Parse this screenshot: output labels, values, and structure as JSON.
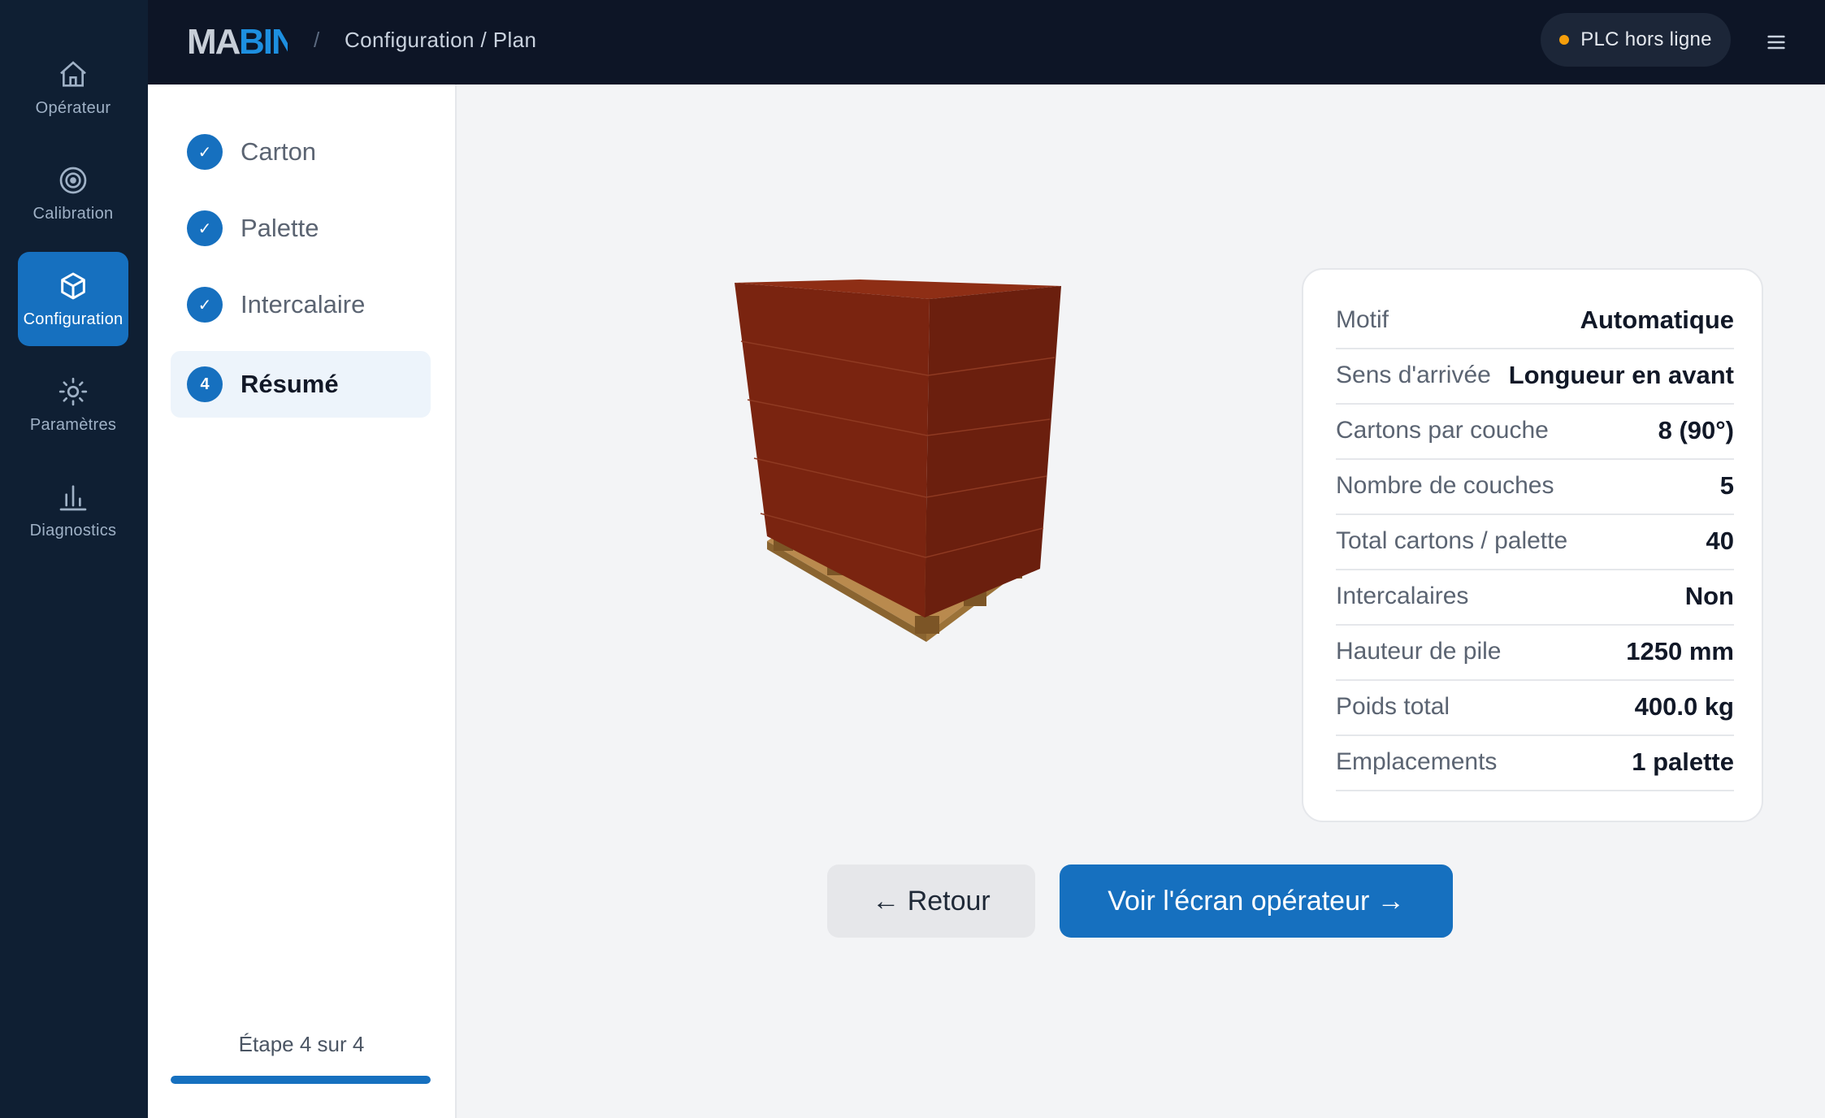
{
  "nav": [
    {
      "label": "Opérateur",
      "icon": "home-icon",
      "active": false
    },
    {
      "label": "Calibration",
      "icon": "target-icon",
      "active": false
    },
    {
      "label": "Configuration",
      "icon": "cube-icon",
      "active": true
    },
    {
      "label": "Paramètres",
      "icon": "gear-icon",
      "active": false
    },
    {
      "label": "Diagnostics",
      "icon": "bar-chart-icon",
      "active": false
    }
  ],
  "header": {
    "logo": "MABIN",
    "separator": "/",
    "breadcrumb": "Configuration / Plan",
    "plc_status": "PLC hors ligne",
    "plc_color": "#f59e0b"
  },
  "steps": [
    {
      "label": "Carton",
      "badge": "✓",
      "state": "done"
    },
    {
      "label": "Palette",
      "badge": "✓",
      "state": "done"
    },
    {
      "label": "Intercalaire",
      "badge": "✓",
      "state": "done"
    },
    {
      "label": "Résumé",
      "badge": "4",
      "state": "current"
    }
  ],
  "progress": {
    "text": "Étape 4 sur 4",
    "fraction": 1.0
  },
  "summary": [
    {
      "key": "Motif",
      "value": "Automatique"
    },
    {
      "key": "Sens d'arrivée",
      "value": "Longueur en avant"
    },
    {
      "key": "Cartons par couche",
      "value": "8 (90°)"
    },
    {
      "key": "Nombre de couches",
      "value": "5"
    },
    {
      "key": "Total cartons / palette",
      "value": "40"
    },
    {
      "key": "Intercalaires",
      "value": "Non"
    },
    {
      "key": "Hauteur de pile",
      "value": "1250 mm"
    },
    {
      "key": "Poids total",
      "value": "400.0 kg"
    },
    {
      "key": "Emplacements",
      "value": "1 palette"
    }
  ],
  "buttons": {
    "back": "← Retour",
    "next": "Voir l'écran opérateur →"
  },
  "colors": {
    "accent": "#1670bf",
    "sidebar_bg": "#0f1f33",
    "topbar_bg": "#0d1526",
    "carton": "#7a2410"
  }
}
